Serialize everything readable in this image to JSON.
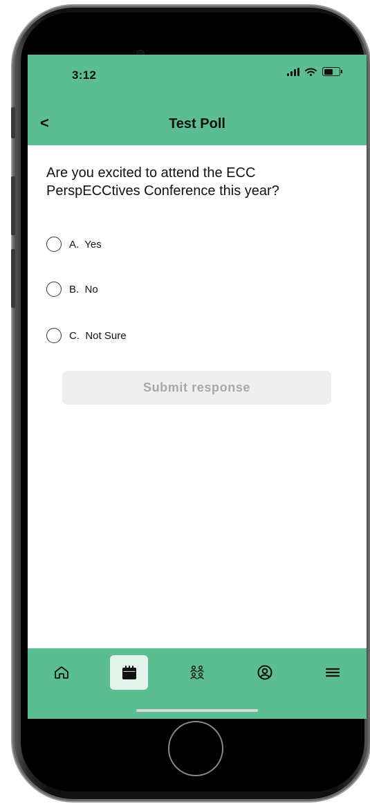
{
  "status_bar": {
    "time": "3:12"
  },
  "header": {
    "back_label": "<",
    "title": "Test Poll"
  },
  "poll": {
    "question": "Are you excited to attend the ECC PerspECCtives Conference this year?",
    "options": [
      {
        "letter": "A.",
        "text": "Yes",
        "selected": false
      },
      {
        "letter": "B.",
        "text": "No",
        "selected": false
      },
      {
        "letter": "C.",
        "text": "Not Sure",
        "selected": false
      }
    ],
    "submit_label": "Submit response",
    "submit_enabled": false
  },
  "bottom_nav": {
    "items": [
      {
        "icon": "home-icon",
        "active": false
      },
      {
        "icon": "calendar-icon",
        "active": true
      },
      {
        "icon": "people-icon",
        "active": false
      },
      {
        "icon": "profile-icon",
        "active": false
      },
      {
        "icon": "menu-icon",
        "active": false
      }
    ]
  },
  "colors": {
    "accent": "#5bbd91",
    "active_tab_bg": "#e4f3ec",
    "submit_disabled_bg": "#efefef",
    "submit_disabled_text": "#a8a8a8"
  }
}
